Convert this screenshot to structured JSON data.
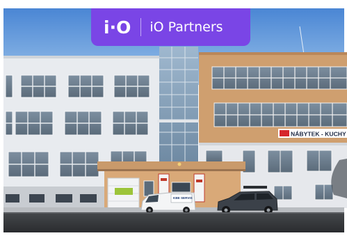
{
  "badge": {
    "logo_text": "i·O",
    "brand_name": "iO Partners",
    "background": "#7a45e6"
  },
  "photo": {
    "storefront_sign": "NÁBYTEK - KUCHY",
    "van_text": "KBE SERVIS"
  }
}
